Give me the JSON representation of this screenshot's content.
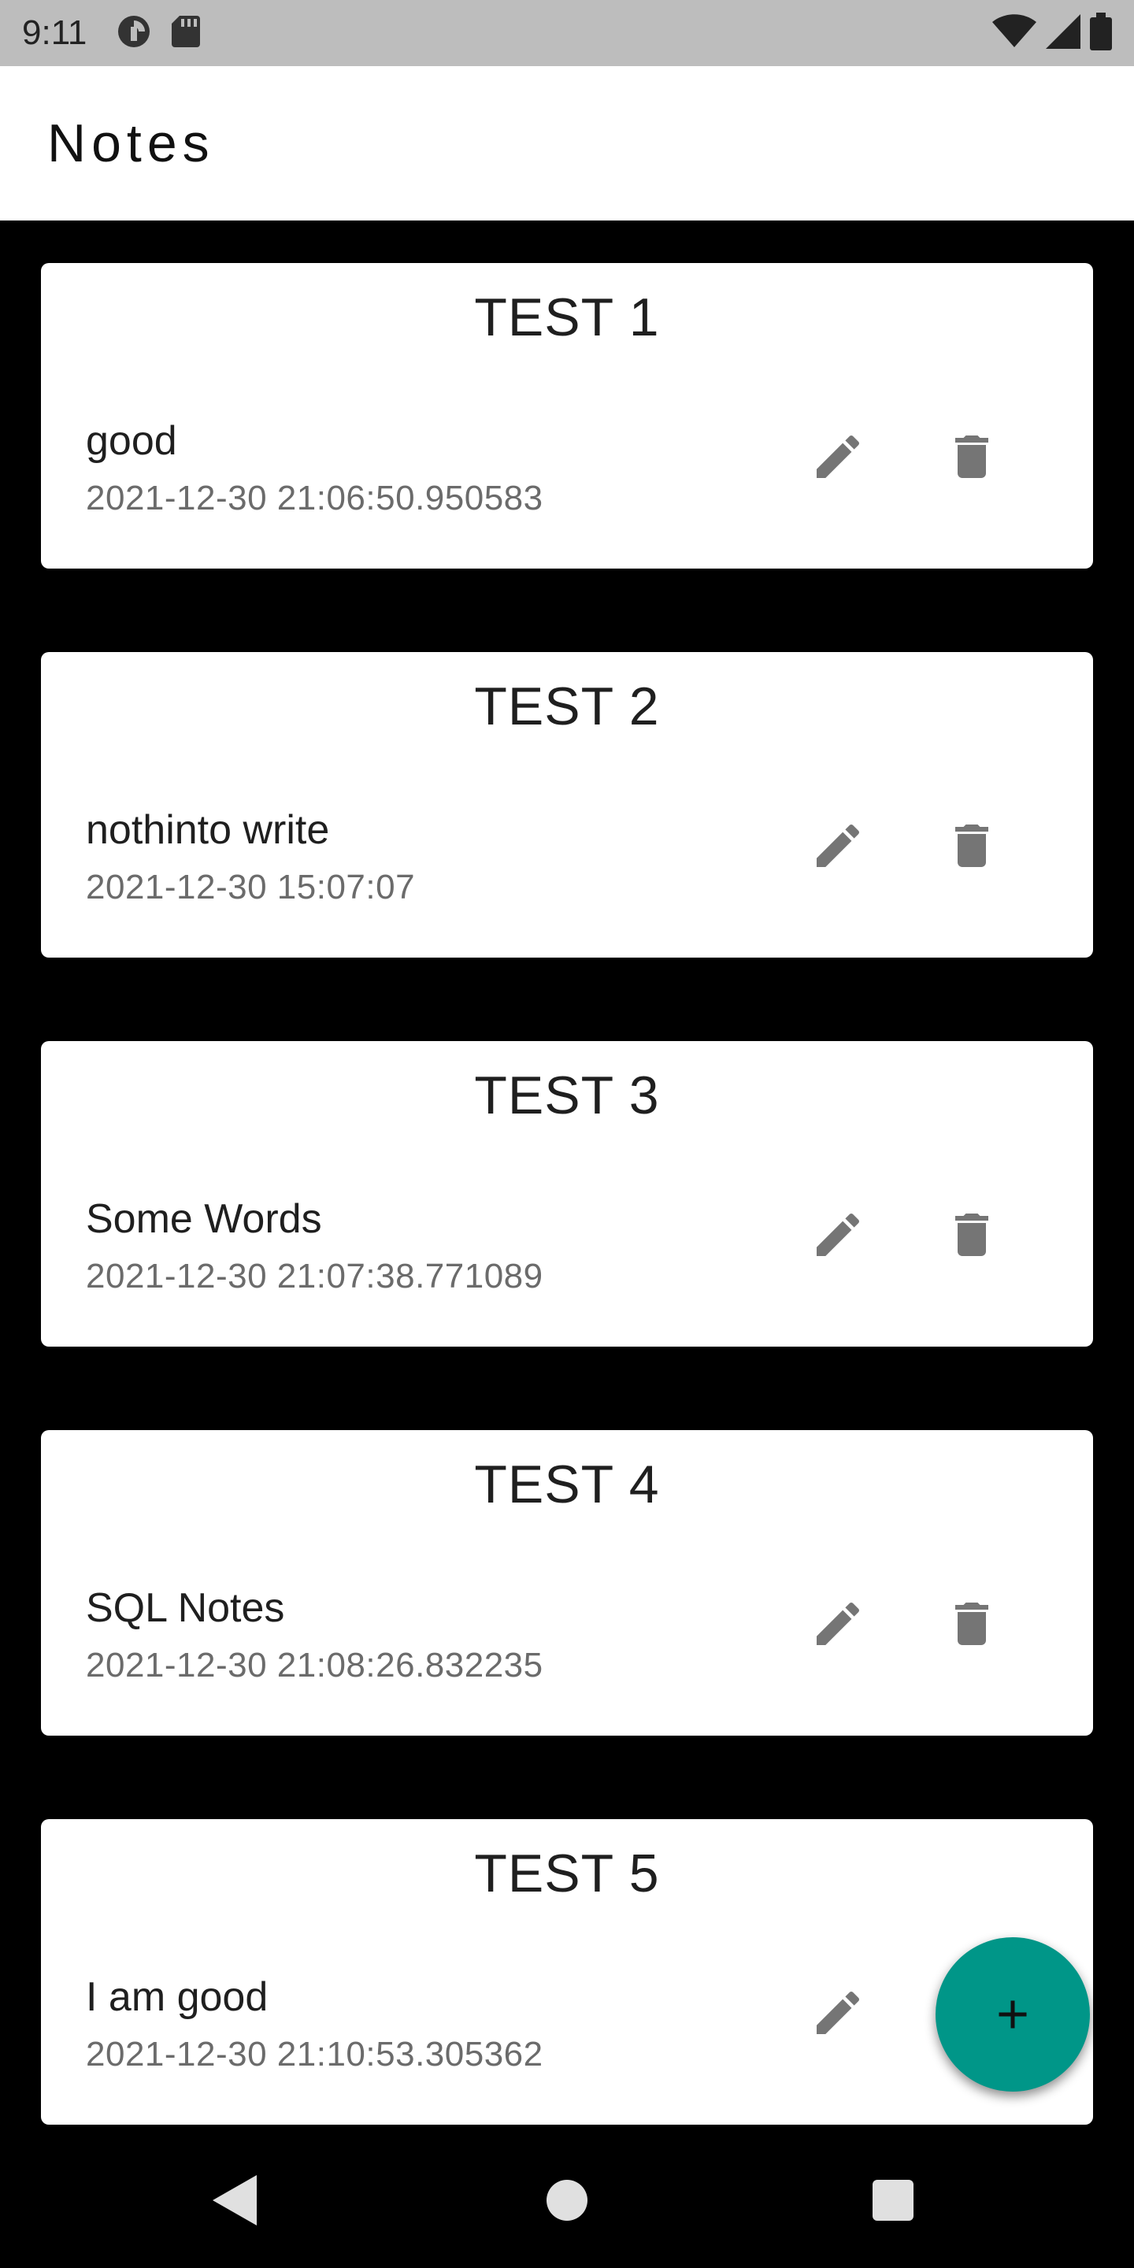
{
  "status_bar": {
    "time": "9:11",
    "icons_left": [
      "data-saver-icon",
      "sd-card-icon"
    ],
    "icons_right": [
      "wifi-icon",
      "cell-signal-icon",
      "battery-icon"
    ]
  },
  "app_bar": {
    "title": "Notes"
  },
  "notes": [
    {
      "title": "TEST 1",
      "body": "good",
      "date": "2021-12-30 21:06:50.950583"
    },
    {
      "title": "TEST 2",
      "body": "nothinto write",
      "date": "2021-12-30 15:07:07"
    },
    {
      "title": "TEST 3",
      "body": "Some Words",
      "date": "2021-12-30 21:07:38.771089"
    },
    {
      "title": "TEST 4",
      "body": "SQL Notes",
      "date": "2021-12-30 21:08:26.832235"
    },
    {
      "title": "TEST 5",
      "body": "I am good",
      "date": "2021-12-30 21:10:53.305362"
    }
  ],
  "actions": {
    "edit_icon": "pencil-icon",
    "delete_icon": "trash-icon"
  },
  "fab": {
    "icon": "plus-icon",
    "color": "#009688"
  },
  "nav_bar": {
    "icons": [
      "back-triangle-icon",
      "home-circle-icon",
      "recents-square-icon"
    ]
  },
  "colors": {
    "background": "#000000",
    "card": "#ffffff",
    "status_bar": "#bdbdbd",
    "icon_gray": "#757575"
  }
}
